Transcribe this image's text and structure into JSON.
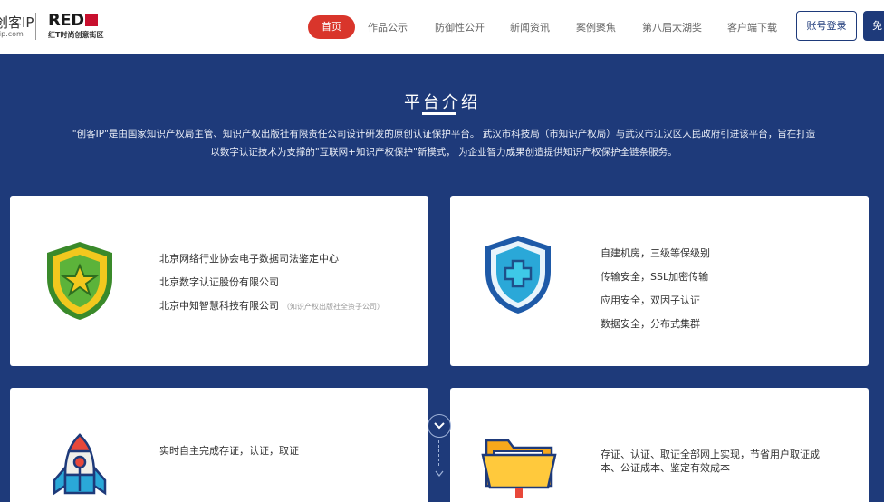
{
  "header": {
    "logo_text": "创客IP",
    "logo_domain": "-ip.com",
    "partner_logo_text": "RED",
    "partner_logo_sub": "红T时尚创意街区",
    "nav": [
      {
        "label": "首页",
        "active": true
      },
      {
        "label": "作品公示"
      },
      {
        "label": "防御性公开"
      },
      {
        "label": "新闻资讯"
      },
      {
        "label": "案例聚焦"
      },
      {
        "label": "第八届太湖奖"
      },
      {
        "label": "客户端下载"
      }
    ],
    "login_label": "账号登录",
    "free_label": "免"
  },
  "section": {
    "title": "平台介绍",
    "intro_line1": "\"创客IP\"是由国家知识产权局主管、知识产权出版社有限责任公司设计研发的原创认证保护平台。 武汉市科技局（市知识产权局）与武汉市江汉区人民政府引进该平台，旨在打造",
    "intro_line2": "以数字认证技术为支撑的\"互联网+知识产权保护\"新模式， 为企业智力成果创造提供知识产权保护全链条服务。"
  },
  "cards": {
    "card1": {
      "icon": "shield-star-icon",
      "lines": [
        "北京网络行业协会电子数据司法鉴定中心",
        "北京数字认证股份有限公司",
        "北京中知智慧科技有限公司"
      ],
      "note": "（知识产权出版社全资子公司）"
    },
    "card2": {
      "icon": "shield-plus-icon",
      "lines": [
        "自建机房，三级等保级别",
        "传输安全，SSL加密传输",
        "应用安全，双因子认证",
        "数据安全，分布式集群"
      ]
    },
    "card3": {
      "icon": "rocket-icon",
      "lines": [
        "实时自主完成存证，认证，取证"
      ]
    },
    "card4": {
      "icon": "folder-icon",
      "lines": [
        "存证、认证、取证全部网上实现，节省用户取证成",
        "本、公证成本、鉴定有效成本"
      ]
    }
  },
  "colors": {
    "brand_blue": "#1e3a7a",
    "active_red": "#d9352b"
  }
}
